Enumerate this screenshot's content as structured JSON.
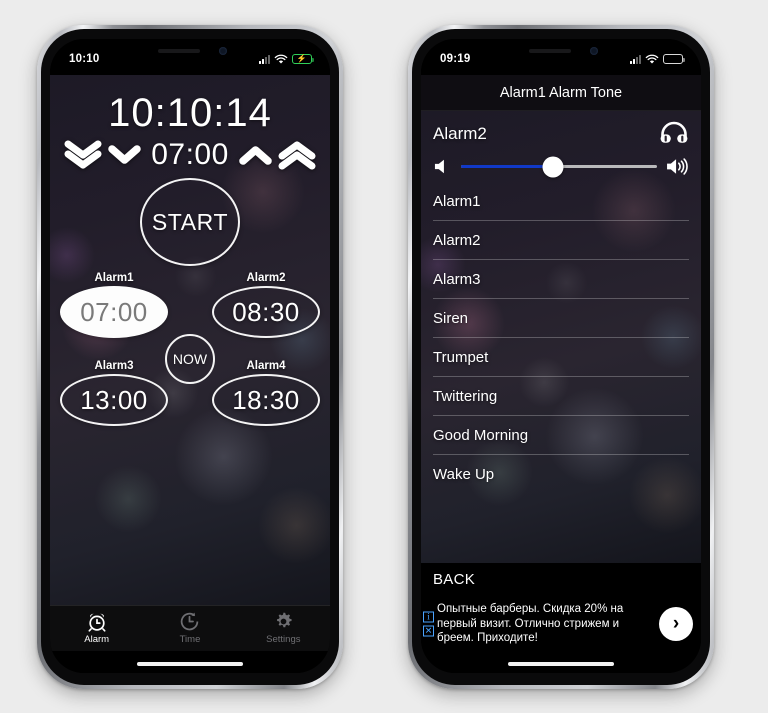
{
  "scene": {
    "background_color": "#ececec",
    "phones": 2
  },
  "left_phone": {
    "status_bar": {
      "time": "10:10",
      "signal_icon": "cellular-bars-icon",
      "wifi_icon": "wifi-icon",
      "battery_icon": "battery-charging-icon",
      "battery_charging": true,
      "battery_color": "#30d158"
    },
    "app": {
      "current_time": "10:10:14",
      "adjust": {
        "big_down_icon": "double-chevron-down-icon",
        "small_down_icon": "chevron-down-icon",
        "value": "07:00",
        "small_up_icon": "chevron-up-icon",
        "big_up_icon": "double-chevron-up-icon"
      },
      "start_label": "START",
      "now_label": "NOW",
      "alarms": [
        {
          "label": "Alarm1",
          "time": "07:00",
          "active": true
        },
        {
          "label": "Alarm2",
          "time": "08:30",
          "active": false
        },
        {
          "label": "Alarm3",
          "time": "13:00",
          "active": false
        },
        {
          "label": "Alarm4",
          "time": "18:30",
          "active": false
        }
      ]
    },
    "tabbar": {
      "tabs": [
        {
          "label": "Alarm",
          "icon": "alarm-clock-icon",
          "active": true
        },
        {
          "label": "Time",
          "icon": "clock-icon",
          "active": false
        },
        {
          "label": "Settings",
          "icon": "gear-icon",
          "active": false
        }
      ]
    }
  },
  "right_phone": {
    "status_bar": {
      "time": "09:19",
      "signal_icon": "cellular-bars-icon",
      "wifi_icon": "wifi-icon",
      "battery_icon": "battery-icon",
      "battery_charging": false,
      "battery_color": "#ffffff"
    },
    "nav_title": "Alarm1 Alarm Tone",
    "selected_tone": "Alarm2",
    "headphones_icon": "headphones-icon",
    "volume": {
      "mute_icon": "speaker-low-icon",
      "max_icon": "speaker-high-icon",
      "value_percent": 47,
      "fill_color": "#1139c8",
      "track_color": "#b9b9bb"
    },
    "tone_list": [
      "Alarm1",
      "Alarm2",
      "Alarm3",
      "Siren",
      "Trumpet",
      "Twittering",
      "Good Morning",
      "Wake Up"
    ],
    "back_label": "BACK",
    "ad": {
      "info_mark": "i",
      "close_mark": "✕",
      "text": "Опытные барберы. Скидка 20% на первый визит. Отлично стрижем и бреем. Приходите!",
      "cta_icon": "chevron-right-icon",
      "cta_label": "›"
    }
  }
}
